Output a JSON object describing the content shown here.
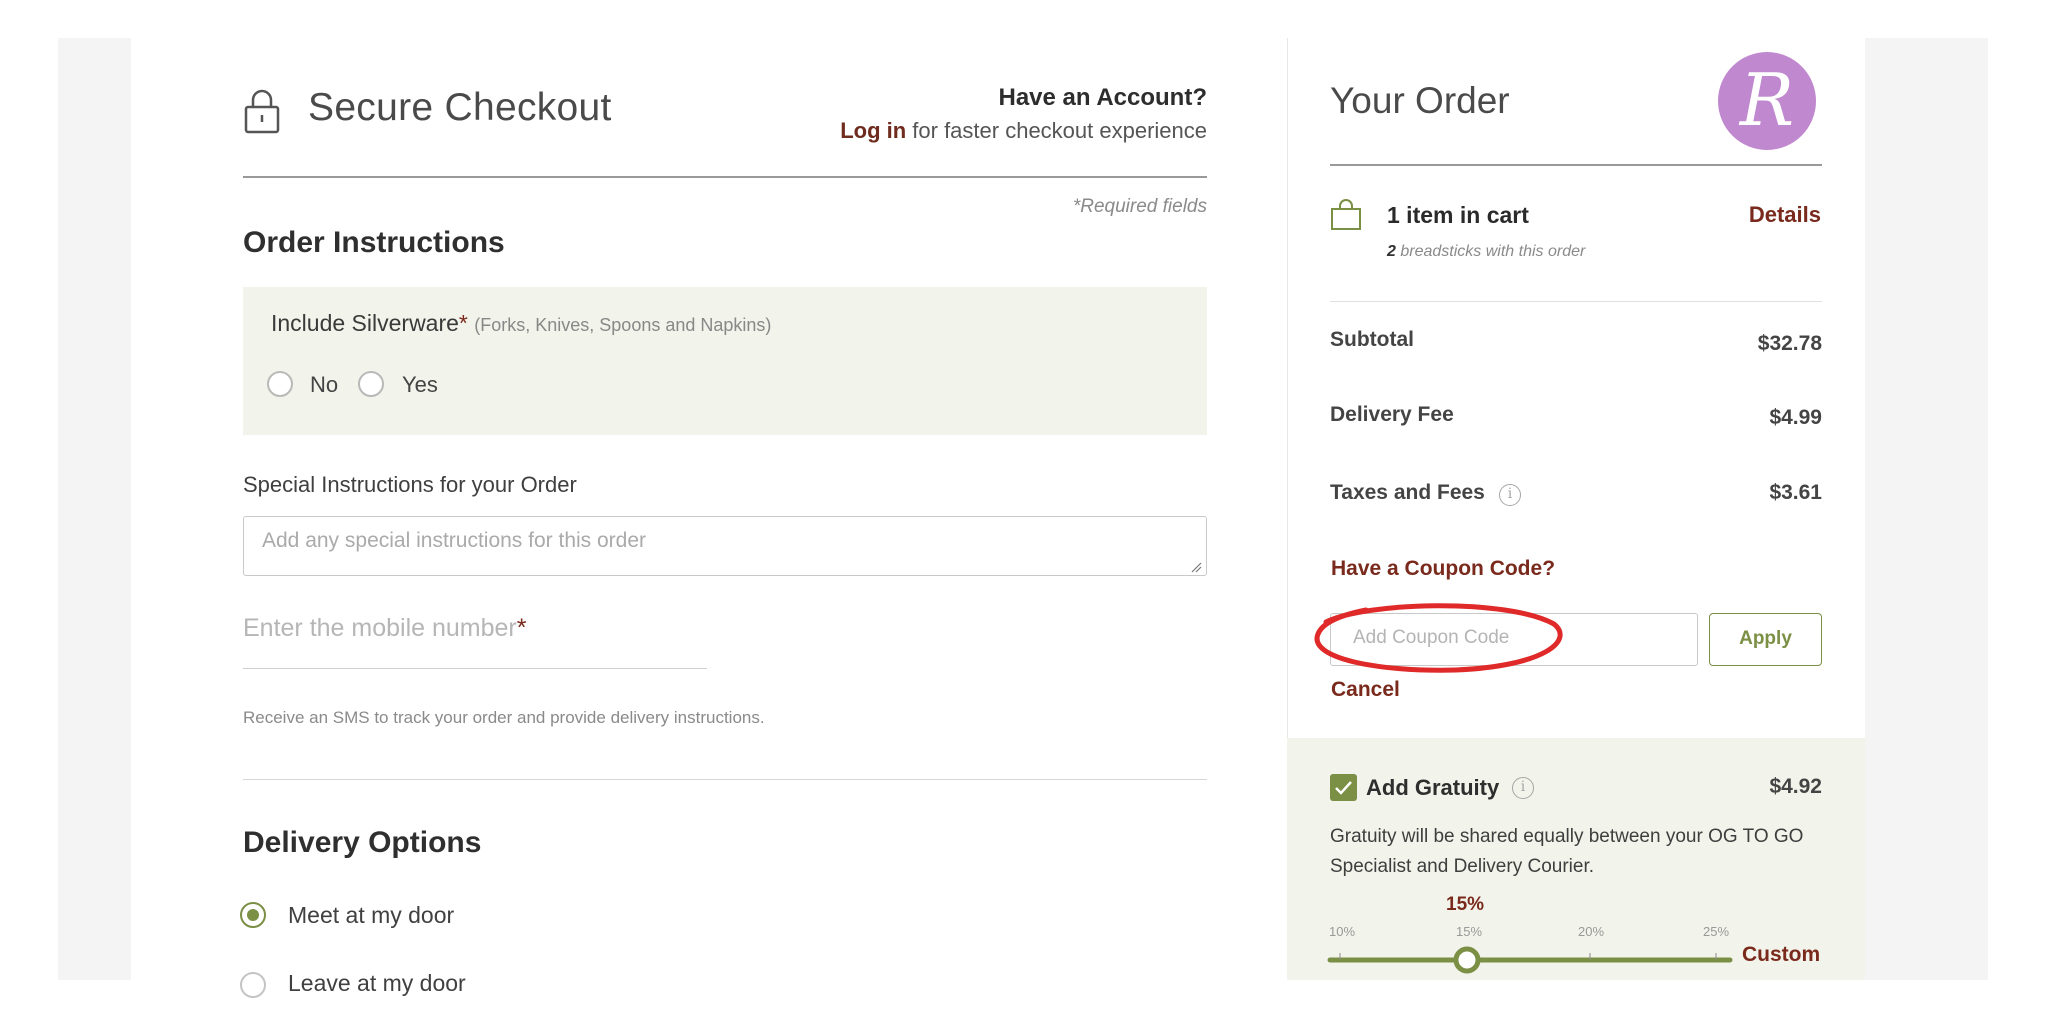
{
  "checkout": {
    "title": "Secure Checkout",
    "account_heading": "Have an Account?",
    "login_link": "Log in",
    "login_suffix": " for faster checkout experience",
    "required_note": "*Required fields"
  },
  "order_instructions": {
    "title": "Order Instructions",
    "silverware_label": "Include Silverware",
    "required_marker": "*",
    "silverware_hint": "(Forks, Knives, Spoons and Napkins)",
    "options": [
      "No",
      "Yes"
    ],
    "special_label": "Special Instructions for your Order",
    "special_placeholder": "Add any special instructions for this order",
    "mobile_label": "Enter the mobile number",
    "sms_note": "Receive an SMS to track your order and provide delivery instructions."
  },
  "delivery": {
    "title": "Delivery Options",
    "selected_option": "Meet at my door",
    "next_option_partial": "Leave at my door"
  },
  "order": {
    "title": "Your Order",
    "logo_letter": "R",
    "cart_count": "1 item in cart",
    "breadsticks_count": "2",
    "breadsticks_note": " breadsticks with this order",
    "details_link": "Details",
    "summary": [
      {
        "label": "Subtotal",
        "value": "$32.78"
      },
      {
        "label": "Delivery Fee",
        "value": "$4.99"
      },
      {
        "label": "Taxes and Fees",
        "value": "$3.61"
      }
    ],
    "coupon_title": "Have a Coupon Code?",
    "coupon_placeholder": "Add Coupon Code",
    "apply_label": "Apply",
    "cancel_label": "Cancel"
  },
  "gratuity": {
    "label": "Add Gratuity",
    "checked": true,
    "amount": "$4.92",
    "note": "Gratuity will be shared equally between your OG TO GO Specialist and Delivery Courier.",
    "current": "15%",
    "ticks": [
      "10%",
      "15%",
      "20%",
      "25%"
    ],
    "custom_label": "Custom"
  },
  "colors": {
    "accent_green": "#7b8f45",
    "accent_maroon": "#7a2a1c",
    "panel_bg": "#f2f3ea",
    "logo_purple": "#c088cf",
    "annotation_red": "#e02a2a"
  },
  "icons": [
    "lock-icon",
    "shopping-bag-icon",
    "info-icon",
    "check-icon",
    "resize-grip-icon"
  ]
}
